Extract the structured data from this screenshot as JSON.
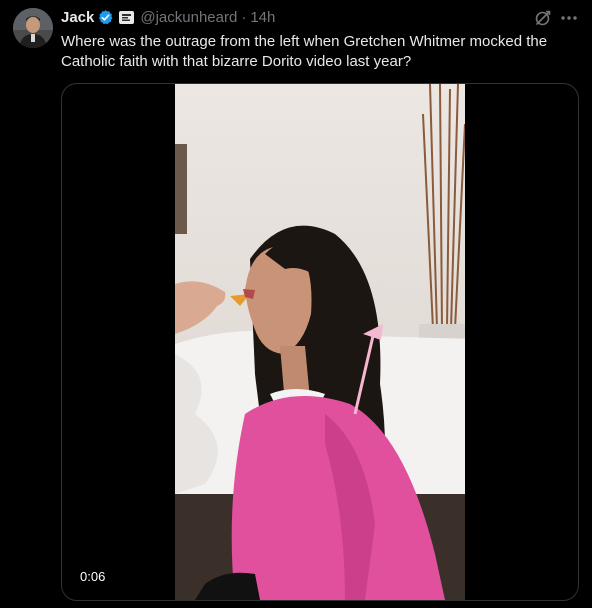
{
  "tweet": {
    "author_name": "Jack",
    "handle": "@jackunheard",
    "separator": "·",
    "time": "14h",
    "text": "Where was the outrage from the left when Gretchen Whitmer mocked the Catholic faith with that bizarre Dorito video last year?",
    "verified_icon": "verified-badge-icon",
    "affiliate_icon": "affiliate-badge-icon",
    "grok_icon": "grok-icon",
    "more_icon": "more-icon",
    "video": {
      "duration": "0:06"
    }
  },
  "colors": {
    "background": "#000000",
    "text_primary": "#e7e9ea",
    "text_secondary": "#71767b",
    "verified_blue": "#1d9bf0",
    "border": "#2f3336"
  }
}
